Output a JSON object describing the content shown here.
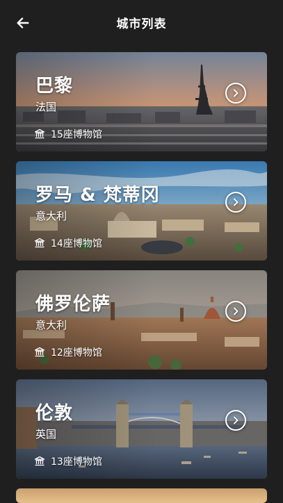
{
  "header": {
    "title": "城市列表",
    "back_icon": "arrow-left-icon"
  },
  "cities": [
    {
      "name": "巴黎",
      "country": "法国",
      "museums": "15座博物馆"
    },
    {
      "name": "罗马 & 梵蒂冈",
      "country": "意大利",
      "museums": "14座博物馆"
    },
    {
      "name": "佛罗伦萨",
      "country": "意大利",
      "museums": "12座博物馆"
    },
    {
      "name": "伦敦",
      "country": "英国",
      "museums": "13座博物馆"
    }
  ],
  "colors": {
    "background": "#1f1f1f",
    "text": "#ffffff"
  },
  "icons": {
    "museum": "museum-icon",
    "next": "chevron-right-circle-icon"
  }
}
